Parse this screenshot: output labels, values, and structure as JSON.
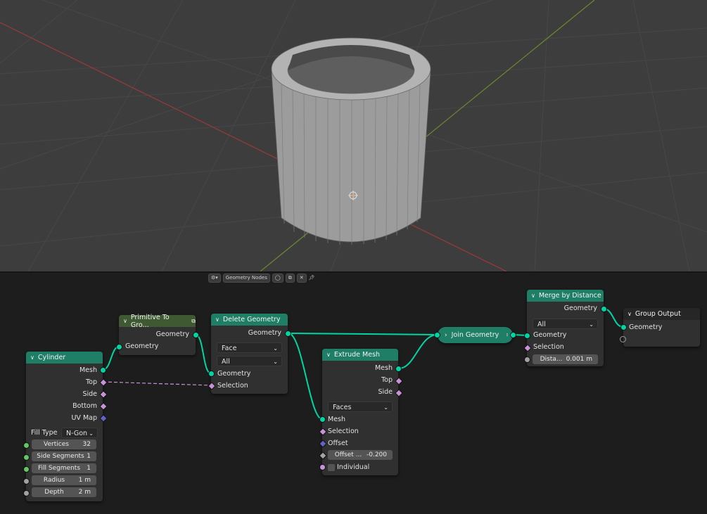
{
  "viewport": {
    "colors": {
      "background": "#3d3d3d",
      "grid": "#4a4a4a",
      "x_axis": "#9c3a3a",
      "y_axis": "#6a8a2e",
      "mesh": "#a8a8a8"
    },
    "object": "cylinder-tube"
  },
  "editor": {
    "tree_type_icon": "node-tree-icon",
    "tree_name": "Geometry Nodes",
    "header_icons": [
      "shield-icon",
      "copy-icon",
      "close-icon",
      "pin-icon"
    ]
  },
  "nodes": {
    "cylinder": {
      "title": "Cylinder",
      "outputs": [
        "Mesh",
        "Top",
        "Side",
        "Bottom",
        "UV Map"
      ],
      "fill_type_label": "Fill Type",
      "fill_type_value": "N-Gon",
      "fields": [
        {
          "label": "Vertices",
          "value": "32"
        },
        {
          "label": "Side Segments",
          "value": "1"
        },
        {
          "label": "Fill Segments",
          "value": "1"
        },
        {
          "label": "Radius",
          "value": "1 m"
        },
        {
          "label": "Depth",
          "value": "2 m"
        }
      ]
    },
    "primitive": {
      "title": "Primitive To Gro...",
      "output": "Geometry",
      "input": "Geometry"
    },
    "delete": {
      "title": "Delete Geometry",
      "output": "Geometry",
      "domain": "Face",
      "mode": "All",
      "inputs": [
        "Geometry",
        "Selection"
      ]
    },
    "extrude": {
      "title": "Extrude Mesh",
      "outputs": [
        "Mesh",
        "Top",
        "Side"
      ],
      "mode": "Faces",
      "inputs": [
        "Mesh",
        "Selection",
        "Offset"
      ],
      "offset_label": "Offset ...",
      "offset_value": "-0.200",
      "individual_label": "Individual"
    },
    "join": {
      "title": "Join Geometry"
    },
    "merge": {
      "title": "Merge by Distance",
      "output": "Geometry",
      "mode": "All",
      "inputs": [
        "Geometry",
        "Selection"
      ],
      "distance_label": "Dista...",
      "distance_value": "0.001 m"
    },
    "group_output": {
      "title": "Group Output",
      "input": "Geometry"
    }
  }
}
